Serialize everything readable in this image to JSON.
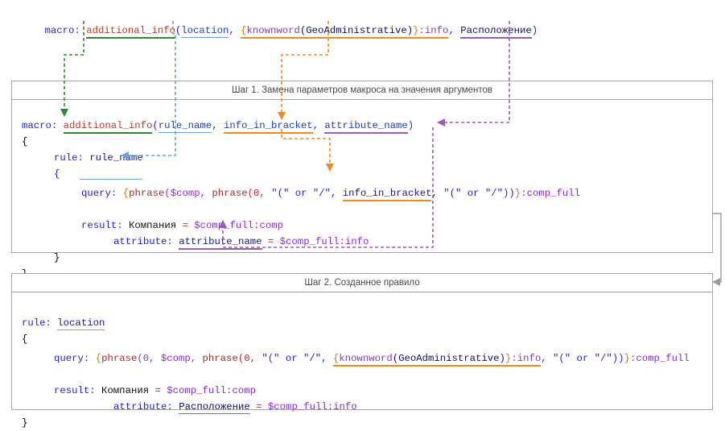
{
  "macro_call": {
    "prefix": "macro:",
    "name": "additional_info",
    "open": "(",
    "arg1": "location",
    "sep1": ", ",
    "arg2_brace_open": "{",
    "arg2_func": "knownword",
    "arg2_inner": "(GeoAdministrative)",
    "arg2_brace_close": "}",
    "arg2_field": ":info",
    "sep2": ", ",
    "arg3": "Расположение",
    "close": ")"
  },
  "step1": {
    "title": "Шаг 1. Замена параметров макроса на значения аргументов",
    "line_macro_prefix": "macro:",
    "line_macro_name": "additional_info",
    "line_open": "(",
    "p1": "rule_name",
    "sep1": ", ",
    "p2": "info_in_bracket",
    "sep2": ", ",
    "p3": "attribute_name",
    "line_close": ")",
    "brace_open": "{",
    "rule_kw": "rule:",
    "rule_val": "rule_name",
    "inner_brace_open": "{",
    "query_kw": "query:",
    "query_b1": "{",
    "query_f1": "phrase",
    "query_p1": "($comp, ",
    "query_f2": "phrase",
    "query_p2": "(0, ",
    "query_s1": "\"(\" or \"/\"",
    "query_sep": ", ",
    "query_arg": "info_in_bracket",
    "query_sep2": ", ",
    "query_s2": "\"(\" or \"/\"",
    "query_tail": "))",
    "query_b2": "}",
    "query_field": ":comp_full",
    "result_kw": "result:",
    "result_name": "Компания",
    "result_eq": "=",
    "result_val": "$comp_full:comp",
    "attr_kw": "attribute:",
    "attr_name": "attribute_name",
    "attr_eq": "=",
    "attr_val": "$comp_full:info",
    "inner_brace_close": "}",
    "brace_close": "}"
  },
  "step2": {
    "title": "Шаг 2. Созданное правило",
    "rule_kw": "rule:",
    "rule_val": "location",
    "brace_open": "{",
    "query_kw": "query:",
    "query_b1": "{",
    "query_f1": "phrase",
    "query_p1": "(0, $comp, ",
    "query_f2": "phrase",
    "query_p2": "(0, ",
    "query_s1": "\"(\" or \"/\"",
    "query_sep": ", ",
    "query_arg_brace_open": "{",
    "query_arg_func": "knownword",
    "query_arg_inner": "(GeoAdministrative)",
    "query_arg_brace_close": "}",
    "query_arg_field": ":info",
    "query_sep2": ", ",
    "query_s2": "\"(\" or \"/\"",
    "query_tail": "))",
    "query_b2": "}",
    "query_field": ":comp_full",
    "result_kw": "result:",
    "result_name": "Компания",
    "result_eq": "=",
    "result_val": "$comp_full:comp",
    "attr_kw": "attribute:",
    "attr_name": "Расположение",
    "attr_eq": "=",
    "attr_val": "$comp_full:info",
    "brace_close": "}"
  },
  "colors": {
    "green": "#2e8b2e",
    "blue": "#6a9fd8",
    "orange": "#f08a1e",
    "purple": "#9b5fa8",
    "gray": "#a6a6a6",
    "keyword": "#2323d6",
    "function": "#c0392b"
  }
}
